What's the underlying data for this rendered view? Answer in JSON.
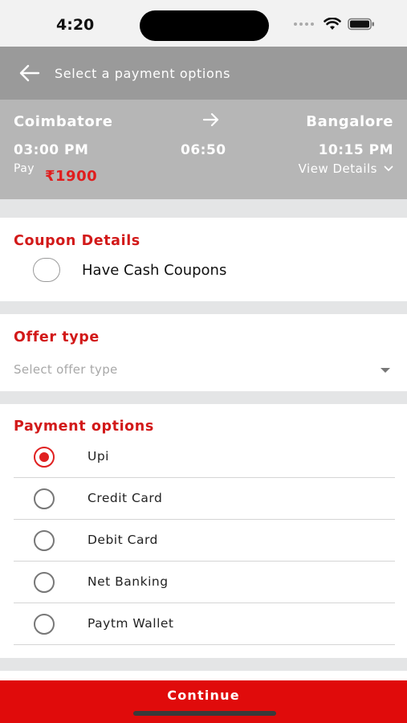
{
  "status_bar": {
    "time": "4:20"
  },
  "header": {
    "title": "Select a payment options",
    "back_icon": "arrow-left-icon"
  },
  "trip": {
    "from": "Coimbatore",
    "to": "Bangalore",
    "departure": "03:00 PM",
    "duration": "06:50",
    "arrival": "10:15 PM",
    "pay_label": "Pay",
    "price": "₹1900",
    "view_details": "View  Details"
  },
  "coupon": {
    "title": "Coupon Details",
    "option_label": "Have Cash Coupons",
    "checked": false
  },
  "offer": {
    "title": "Offer type",
    "placeholder": "Select offer type"
  },
  "payment": {
    "title": "Payment options",
    "options": [
      {
        "label": "Upi",
        "selected": true
      },
      {
        "label": "Credit Card",
        "selected": false
      },
      {
        "label": "Debit Card",
        "selected": false
      },
      {
        "label": "Net Banking",
        "selected": false
      },
      {
        "label": "Paytm Wallet",
        "selected": false
      }
    ]
  },
  "footer": {
    "continue_label": "Continue"
  },
  "colors": {
    "accent": "#e00b0b",
    "header_bg": "#9a9a9a",
    "trip_bg": "#b6b6b6",
    "section_gap": "#e4e5e6"
  }
}
